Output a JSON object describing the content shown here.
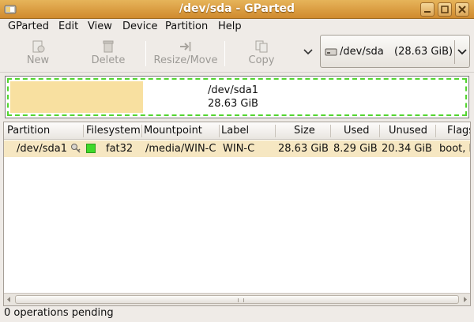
{
  "window": {
    "title": "/dev/sda - GParted"
  },
  "menu": [
    "GParted",
    "Edit",
    "View",
    "Device",
    "Partition",
    "Help"
  ],
  "toolbar": {
    "new_label": "New",
    "delete_label": "Delete",
    "resize_label": "Resize/Move",
    "copy_label": "Copy"
  },
  "device_selector": {
    "device": "/dev/sda",
    "capacity": "(28.63 GiB)"
  },
  "disk_visual": {
    "partition": "/dev/sda1",
    "size": "28.63 GiB",
    "used_fraction": 0.29
  },
  "table": {
    "columns": [
      "Partition",
      "Filesystem",
      "Mountpoint",
      "Label",
      "Size",
      "Used",
      "Unused",
      "Flags"
    ],
    "rows": [
      {
        "partition": "/dev/sda1",
        "filesystem": "fat32",
        "mountpoint": "/media/WIN-C",
        "label": "WIN-C",
        "size": "28.63 GiB",
        "used": "8.29 GiB",
        "unused": "20.34 GiB",
        "flags": "boot, l"
      }
    ]
  },
  "status": {
    "text": "0 operations pending"
  },
  "colors": {
    "fat32": "#3fd92a",
    "used": "#f8e0a0",
    "selection": "#f6e7c2",
    "titlebar": "#d89a3e"
  }
}
